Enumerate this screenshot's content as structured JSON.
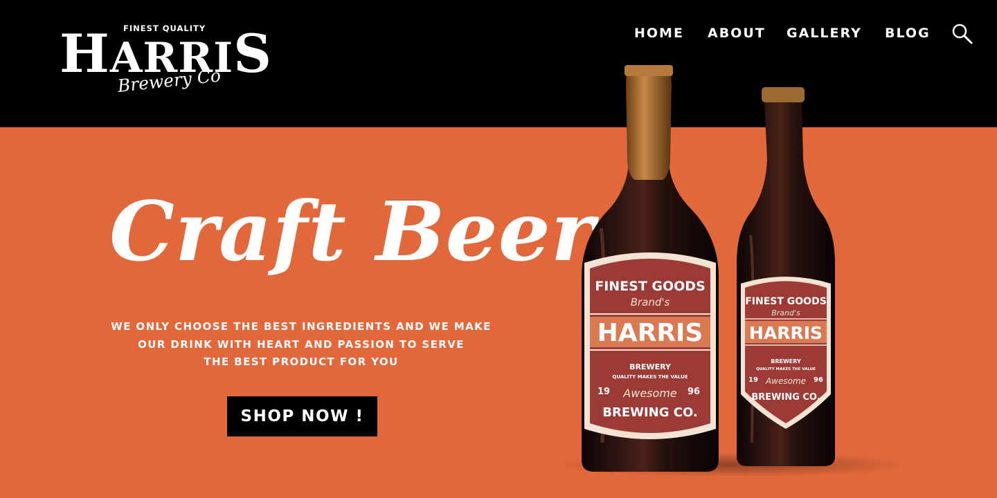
{
  "header": {
    "logo": {
      "tagline": "FINEST QUALITY",
      "wordmark_first": "H",
      "wordmark_middle": "ARRI",
      "wordmark_last": "S",
      "subtitle": "Brewery Co"
    },
    "nav": {
      "home": "HOME",
      "about": "ABOUT",
      "gallery": "GALLERY",
      "blog": "BLOG"
    },
    "search_icon": "search-icon"
  },
  "hero": {
    "title": "Craft Beer",
    "description_lines": [
      "WE ONLY CHOOSE THE BEST INGREDIENTS AND WE MAKE",
      "OUR DRINK WITH HEART AND PASSION TO SERVE",
      "THE BEST PRODUCT FOR YOU"
    ],
    "cta": "SHOP NOW !"
  },
  "labels": {
    "finest_goods": "FINEST GOODS",
    "brands": "Brand's",
    "brand_name": "HARRIS",
    "brewery": "BREWERY",
    "quality": "QUALITY MAKES THE VALUE",
    "year_left": "19",
    "year_right": "96",
    "awesome": "Awesome",
    "brewing": "BREWING CO."
  },
  "colors": {
    "background": "#e2683b",
    "header": "#000000",
    "label": "#9c3a36",
    "label_band": "#d97a53",
    "label_border": "#f2e3d3",
    "bottle": "#1c0e0c",
    "foil": "#a86a2e",
    "text": "#ffffff"
  }
}
